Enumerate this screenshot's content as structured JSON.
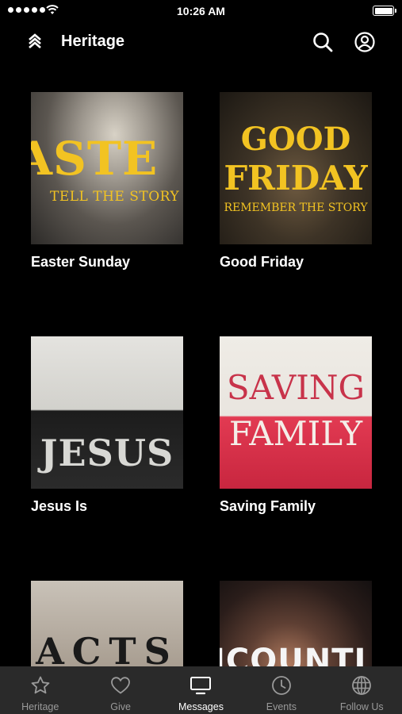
{
  "status_bar": {
    "time": "10:26 AM"
  },
  "header": {
    "title": "Heritage"
  },
  "messages": [
    {
      "title": "Easter Sunday",
      "art_text": [
        "ASTE",
        "TELL THE STORY"
      ]
    },
    {
      "title": "Good Friday",
      "art_text": [
        "GOOD",
        "FRIDAY",
        "REMEMBER THE STORY"
      ]
    },
    {
      "title": "Jesus Is",
      "art_text": [
        "JESUS"
      ]
    },
    {
      "title": "Saving Family",
      "art_text": [
        "SAVING",
        "FAMILY"
      ]
    },
    {
      "title": "",
      "art_text": [
        "ACTS"
      ]
    },
    {
      "title": "",
      "art_text": [
        "ICOUNTI"
      ]
    }
  ],
  "tab_bar": {
    "active": "Messages",
    "tabs": [
      {
        "label": "Heritage",
        "icon": "star-icon"
      },
      {
        "label": "Give",
        "icon": "heart-icon"
      },
      {
        "label": "Messages",
        "icon": "monitor-icon"
      },
      {
        "label": "Events",
        "icon": "clock-icon"
      },
      {
        "label": "Follow Us",
        "icon": "globe-icon"
      }
    ]
  },
  "colors": {
    "background": "#000000",
    "tab_bar": "#2a2a2a",
    "inactive_tab": "#9a9a9a",
    "active_tab": "#ffffff"
  }
}
